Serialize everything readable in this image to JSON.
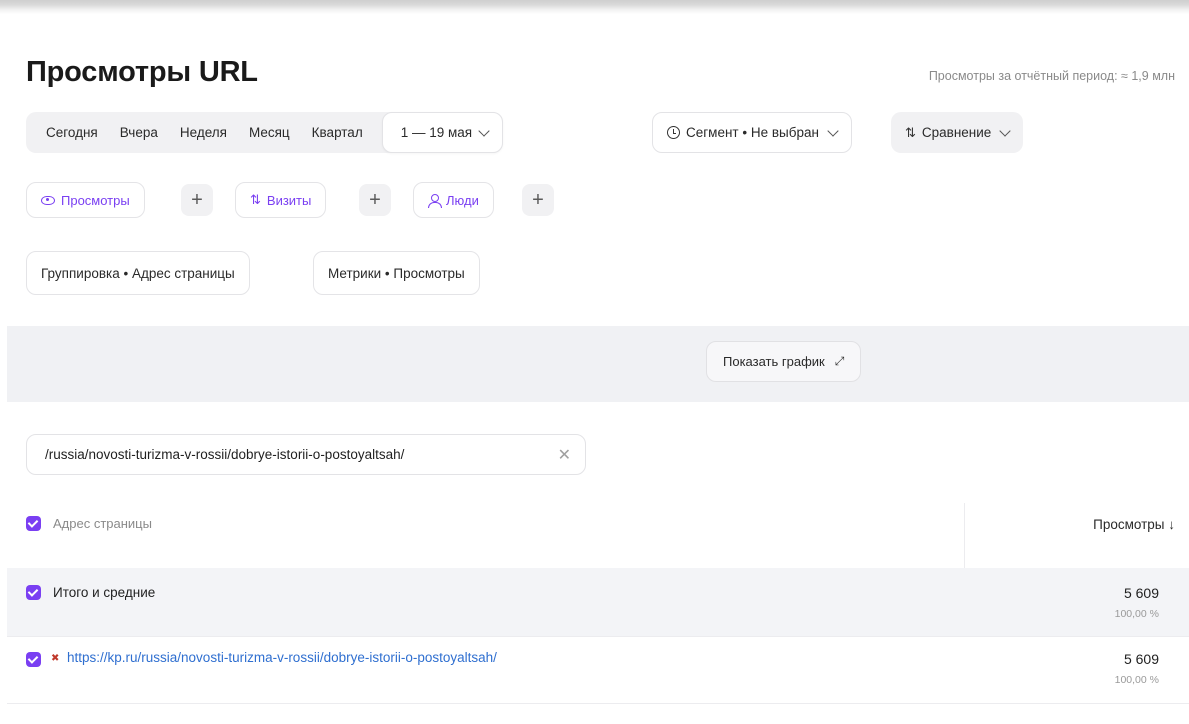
{
  "header": {
    "title": "Просмотры URL",
    "period_stat": "Просмотры за отчётный период: ≈ 1,9 млн"
  },
  "period": {
    "buttons": [
      "Сегодня",
      "Вчера",
      "Неделя",
      "Месяц",
      "Квартал"
    ],
    "range": "1 — 19 мая"
  },
  "segment": {
    "label": "Сегмент • Не выбран"
  },
  "compare": {
    "label": "Сравнение"
  },
  "metrics_chips": [
    {
      "label": "Просмотры",
      "icon": "eye-icon"
    },
    {
      "label": "Визиты",
      "icon": "compare-icon"
    },
    {
      "label": "Люди",
      "icon": "person-icon"
    }
  ],
  "plus": "+",
  "grouping": {
    "group_label": "Группировка • Адрес страницы",
    "metrics_label": "Метрики • Просмотры"
  },
  "chart_toggle": {
    "label": "Показать график"
  },
  "filter": {
    "value": "/russia/novosti-turizma-v-rossii/dobrye-istorii-o-postoyaltsah/"
  },
  "table": {
    "columns": [
      "Адрес страницы",
      "Просмотры ↓"
    ],
    "total": {
      "label": "Итого и средние",
      "value": "5 609",
      "pct": "100,00 %"
    },
    "rows": [
      {
        "url": "https://kp.ru/russia/novosti-turizma-v-rossii/dobrye-istorii-o-postoyaltsah/",
        "value": "5 609",
        "pct": "100,00 %"
      }
    ]
  },
  "colors": {
    "accent": "#7a3ff2",
    "link": "#2f6fd0",
    "band": "#f0f1f4"
  }
}
